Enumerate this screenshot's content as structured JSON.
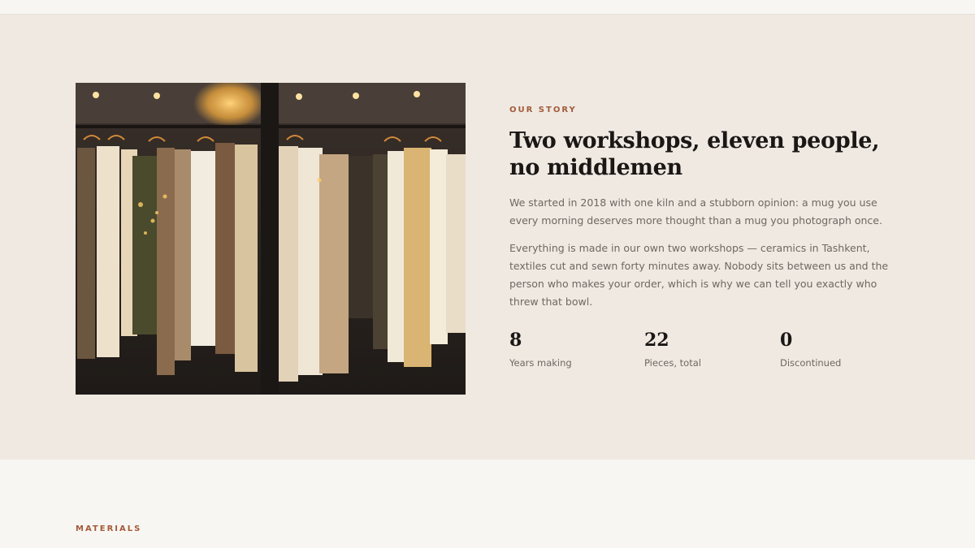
{
  "story": {
    "eyebrow": "OUR STORY",
    "heading": "Two workshops, eleven people, no middlemen",
    "paragraphs": [
      "We started in 2018 with one kiln and a stubborn opinion: a mug you use every morning deserves more thought than a mug you photograph once.",
      "Everything is made in our own two workshops — ceramics in Tashkent, textiles cut and sewn forty minutes away. Nobody sits between us and the person who makes your order, which is why we can tell you exactly who threw that bowl."
    ],
    "stats": [
      {
        "value": "8",
        "label": "Years making"
      },
      {
        "value": "22",
        "label": "Pieces, total"
      },
      {
        "value": "0",
        "label": "Discontinued"
      }
    ],
    "image_icon": "clothing-rack-photo"
  },
  "materials": {
    "eyebrow": "MATERIALS"
  },
  "colors": {
    "accent": "#a35b3a",
    "section_bg": "#efe9e2",
    "page_bg": "#f8f6f2",
    "heading": "#1a1715",
    "body_text": "#6f6862"
  }
}
